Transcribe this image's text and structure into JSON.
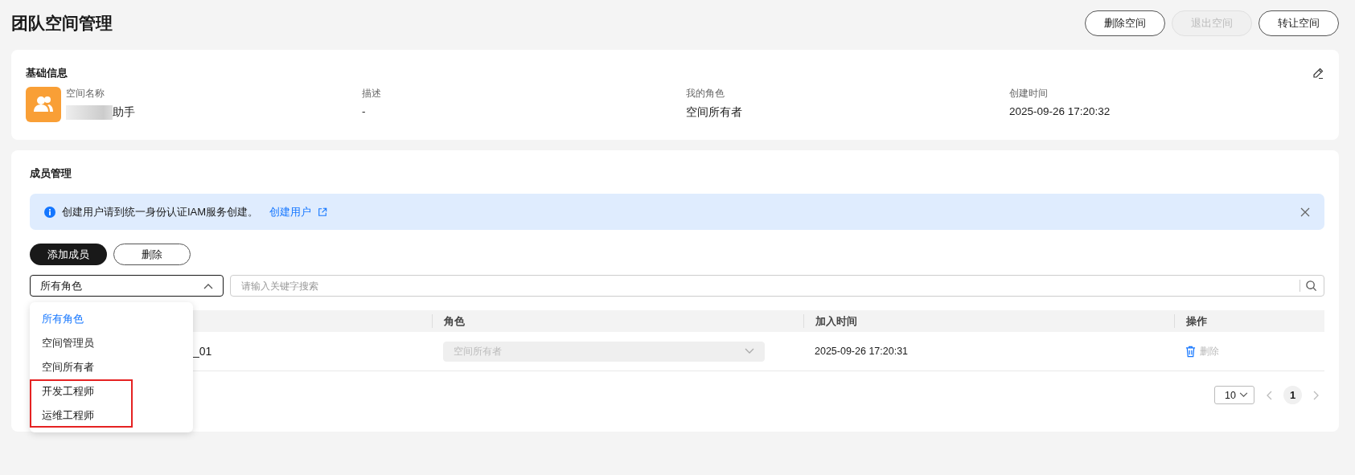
{
  "page_title": "团队空间管理",
  "header_buttons": [
    {
      "label": "删除空间",
      "disabled": false
    },
    {
      "label": "退出空间",
      "disabled": true
    },
    {
      "label": "转让空间",
      "disabled": false
    }
  ],
  "basic_info": {
    "title": "基础信息",
    "fields": [
      {
        "label": "空间名称",
        "value": "助手",
        "redacted": true
      },
      {
        "label": "描述",
        "value": "-",
        "redacted": false
      },
      {
        "label": "我的角色",
        "value": "空间所有者",
        "redacted": false
      },
      {
        "label": "创建时间",
        "value": "2025-09-26 17:20:32",
        "redacted": false
      }
    ]
  },
  "members": {
    "title": "成员管理",
    "notice": {
      "text": "创建用户请到统一身份认证IAM服务创建。",
      "link": "创建用户"
    },
    "actions": [
      {
        "label": "添加成员",
        "primary": true
      },
      {
        "label": "删除",
        "primary": false
      }
    ],
    "role_filter": {
      "value": "所有角色",
      "expanded": true,
      "options": [
        {
          "label": "所有角色",
          "selected": true,
          "highlighted": false
        },
        {
          "label": "空间管理员",
          "selected": false,
          "highlighted": false
        },
        {
          "label": "空间所有者",
          "selected": false,
          "highlighted": false
        },
        {
          "label": "开发工程师",
          "selected": false,
          "highlighted": true
        },
        {
          "label": "运维工程师",
          "selected": false,
          "highlighted": true
        }
      ]
    },
    "search": {
      "placeholder": "请输入关键字搜索"
    },
    "table": {
      "columns": [
        "角色",
        "加入时间",
        "操作"
      ],
      "rows": [
        {
          "column_1": "_01",
          "role": "空间所有者",
          "role_disabled": true,
          "joined": "2025-09-26 17:20:31",
          "action": "删除",
          "action_disabled": true
        }
      ]
    },
    "pagination": {
      "page_size": "10",
      "pages": [
        {
          "label": "1",
          "selected": true
        }
      ]
    }
  }
}
